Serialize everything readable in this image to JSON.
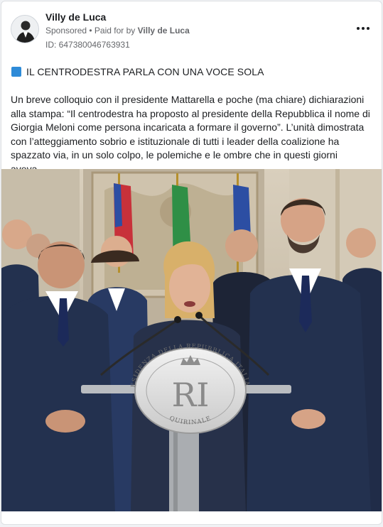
{
  "post": {
    "author": "Villy de Luca",
    "sponsored": "Sponsored",
    "paid_prefix": "• Paid for by",
    "paid_by": "Villy de Luca",
    "ad_id": "ID: 647380046763931",
    "headline": "IL CENTRODESTRA PARLA CON UNA VOCE SOLA",
    "body": "Un breve colloquio con il presidente Mattarella e poche (ma chiare) dichiarazioni alla stampa: “Il centrodestra ha proposto al presidente della Repubblica il nome di Giorgia Meloni come persona incaricata a formare il governo”. L’unità dimostrata con l’atteggiamento sobrio e istituzionale di tutti i leader della coalizione ha spazzato via, in un solo colpo, le polemiche e le ombre che in questi giorni aveva…"
  },
  "photo": {
    "seal_top": "PRESIDENZA DELLA REPUBBLICA ITALIANA",
    "seal_bottom": "QUIRINALE",
    "seal_monogram": "RI"
  },
  "colors": {
    "headline_square": "#2e8bd8",
    "suits": "#23314f",
    "flag_green": "#2f8f46",
    "flag_red": "#c8313a",
    "eu_blue": "#2c4ea3"
  }
}
